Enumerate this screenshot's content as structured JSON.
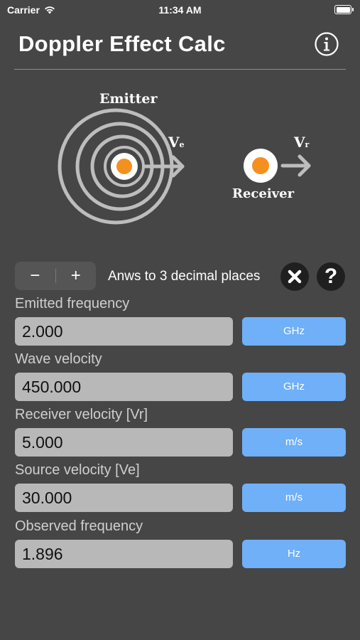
{
  "status_bar": {
    "carrier": "Carrier",
    "time": "11:34 AM"
  },
  "header": {
    "title": "Doppler Effect Calc"
  },
  "diagram": {
    "emitter_label": "Emitter",
    "receiver_label": "Receiver",
    "ve_label": "V",
    "ve_sub": "e",
    "vr_label": "V",
    "vr_sub": "r",
    "dot_color": "#f5901e"
  },
  "controls": {
    "minus_label": "−",
    "plus_label": "+",
    "decimal_text": "Anws to 3 decimal places",
    "help_label": "?"
  },
  "fields": [
    {
      "label": "Emitted frequency",
      "value": "2.000",
      "unit": "GHz"
    },
    {
      "label": "Wave velocity",
      "value": "450.000",
      "unit": "GHz"
    },
    {
      "label": "Receiver velocity [Vr]",
      "value": "5.000",
      "unit": "m/s"
    },
    {
      "label": "Source velocity [Ve]",
      "value": "30.000",
      "unit": "m/s"
    },
    {
      "label": "Observed frequency",
      "value": "1.896",
      "unit": "Hz"
    }
  ],
  "colors": {
    "background": "#464646",
    "unit_button": "#6fb0f8",
    "input": "#b8b8b8",
    "accent_dot": "#f5901e"
  }
}
